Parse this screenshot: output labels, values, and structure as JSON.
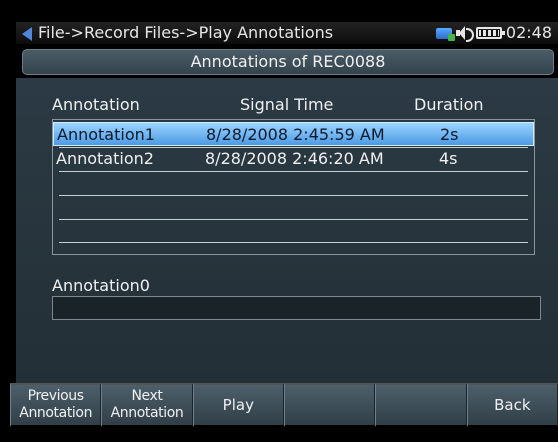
{
  "status_bar": {
    "breadcrumb": "File->Record Files->Play Annotations",
    "clock": "02:48",
    "icons": [
      "back-arrow-icon",
      "network-icon",
      "speaker-icon",
      "battery-icon"
    ]
  },
  "dialog": {
    "title": "Annotations of REC0088"
  },
  "table": {
    "columns": [
      "Annotation",
      "Signal Time",
      "Duration"
    ],
    "rows": [
      {
        "annotation": "Annotation1",
        "signal_time": "8/28/2008 2:45:59 AM",
        "duration": "2s",
        "selected": true
      },
      {
        "annotation": "Annotation2",
        "signal_time": "8/28/2008 2:46:20 AM",
        "duration": "4s",
        "selected": false
      }
    ]
  },
  "annotation_field": {
    "label": "Annotation0",
    "value": ""
  },
  "softkeys": [
    {
      "label": "Previous\nAnnotation"
    },
    {
      "label": "Next\nAnnotation"
    },
    {
      "label": "Play"
    },
    {
      "label": ""
    },
    {
      "label": ""
    },
    {
      "label": "Back"
    }
  ],
  "colors": {
    "selection": "#4c9ae4",
    "panel": "#2b3a44",
    "text": "#f0f0f0",
    "back_arrow": "#4f86d8"
  }
}
